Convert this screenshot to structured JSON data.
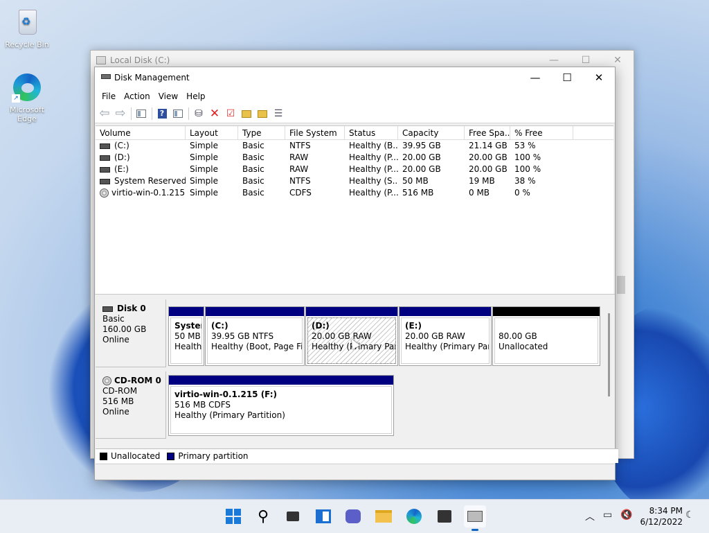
{
  "desktop": {
    "icons": [
      {
        "label": "Recycle Bin"
      },
      {
        "label": "Microsoft Edge"
      }
    ]
  },
  "bg_window": {
    "title": "Local Disk (C:)"
  },
  "window": {
    "title": "Disk Management",
    "min": "—",
    "max": "☐",
    "close": "✕"
  },
  "menu": [
    "File",
    "Action",
    "View",
    "Help"
  ],
  "toolbar_icons": [
    "back-arrow-icon",
    "forward-arrow-icon",
    "show-hide-console-tree-icon",
    "help-icon",
    "properties-icon",
    "connect-drive-icon",
    "delete-icon",
    "checkmark-icon",
    "folder-up-icon",
    "folder-search-icon",
    "list-icon"
  ],
  "columns": [
    "Volume",
    "Layout",
    "Type",
    "File System",
    "Status",
    "Capacity",
    "Free Spa...",
    "% Free"
  ],
  "volumes": [
    {
      "volume": "(C:)",
      "layout": "Simple",
      "type": "Basic",
      "fs": "NTFS",
      "status": "Healthy (B...",
      "capacity": "39.95 GB",
      "free": "21.14 GB",
      "pct": "53 %",
      "icon": "disk"
    },
    {
      "volume": "(D:)",
      "layout": "Simple",
      "type": "Basic",
      "fs": "RAW",
      "status": "Healthy (P...",
      "capacity": "20.00 GB",
      "free": "20.00 GB",
      "pct": "100 %",
      "icon": "disk"
    },
    {
      "volume": "(E:)",
      "layout": "Simple",
      "type": "Basic",
      "fs": "RAW",
      "status": "Healthy (P...",
      "capacity": "20.00 GB",
      "free": "20.00 GB",
      "pct": "100 %",
      "icon": "disk"
    },
    {
      "volume": "System Reserved",
      "layout": "Simple",
      "type": "Basic",
      "fs": "NTFS",
      "status": "Healthy (S...",
      "capacity": "50 MB",
      "free": "19 MB",
      "pct": "38 %",
      "icon": "disk"
    },
    {
      "volume": "virtio-win-0.1.215 ...",
      "layout": "Simple",
      "type": "Basic",
      "fs": "CDFS",
      "status": "Healthy (P...",
      "capacity": "516 MB",
      "free": "0 MB",
      "pct": "0 %",
      "icon": "cd"
    }
  ],
  "disk0": {
    "name": "Disk 0",
    "type": "Basic",
    "size": "160.00 GB",
    "state": "Online",
    "partitions": [
      {
        "name": "System",
        "l2": "50 MB",
        "l3": "Healthy"
      },
      {
        "name": "(C:)",
        "l2": "39.95 GB NTFS",
        "l3": "Healthy (Boot, Page File,"
      },
      {
        "name": "(D:)",
        "l2": "20.00 GB RAW",
        "l3": "Healthy (Primary Partit"
      },
      {
        "name": "(E:)",
        "l2": "20.00 GB RAW",
        "l3": "Healthy (Primary Partit"
      },
      {
        "name": "",
        "l2": "80.00 GB",
        "l3": "Unallocated"
      }
    ]
  },
  "cdrom0": {
    "name": "CD-ROM 0",
    "type": "CD-ROM",
    "size": "516 MB",
    "state": "Online",
    "partition": {
      "name": "virtio-win-0.1.215  (F:)",
      "l2": "516 MB CDFS",
      "l3": "Healthy (Primary Partition)"
    }
  },
  "legend": [
    {
      "label": "Unallocated",
      "color": "#000000"
    },
    {
      "label": "Primary partition",
      "color": "#000080"
    }
  ],
  "taskbar": {
    "time": "8:34 PM",
    "date": "6/12/2022",
    "apps": [
      "start-icon",
      "search-icon",
      "task-view-icon",
      "widgets-icon",
      "chat-icon",
      "file-explorer-icon",
      "edge-icon",
      "store-icon",
      "disk-management-icon"
    ]
  }
}
